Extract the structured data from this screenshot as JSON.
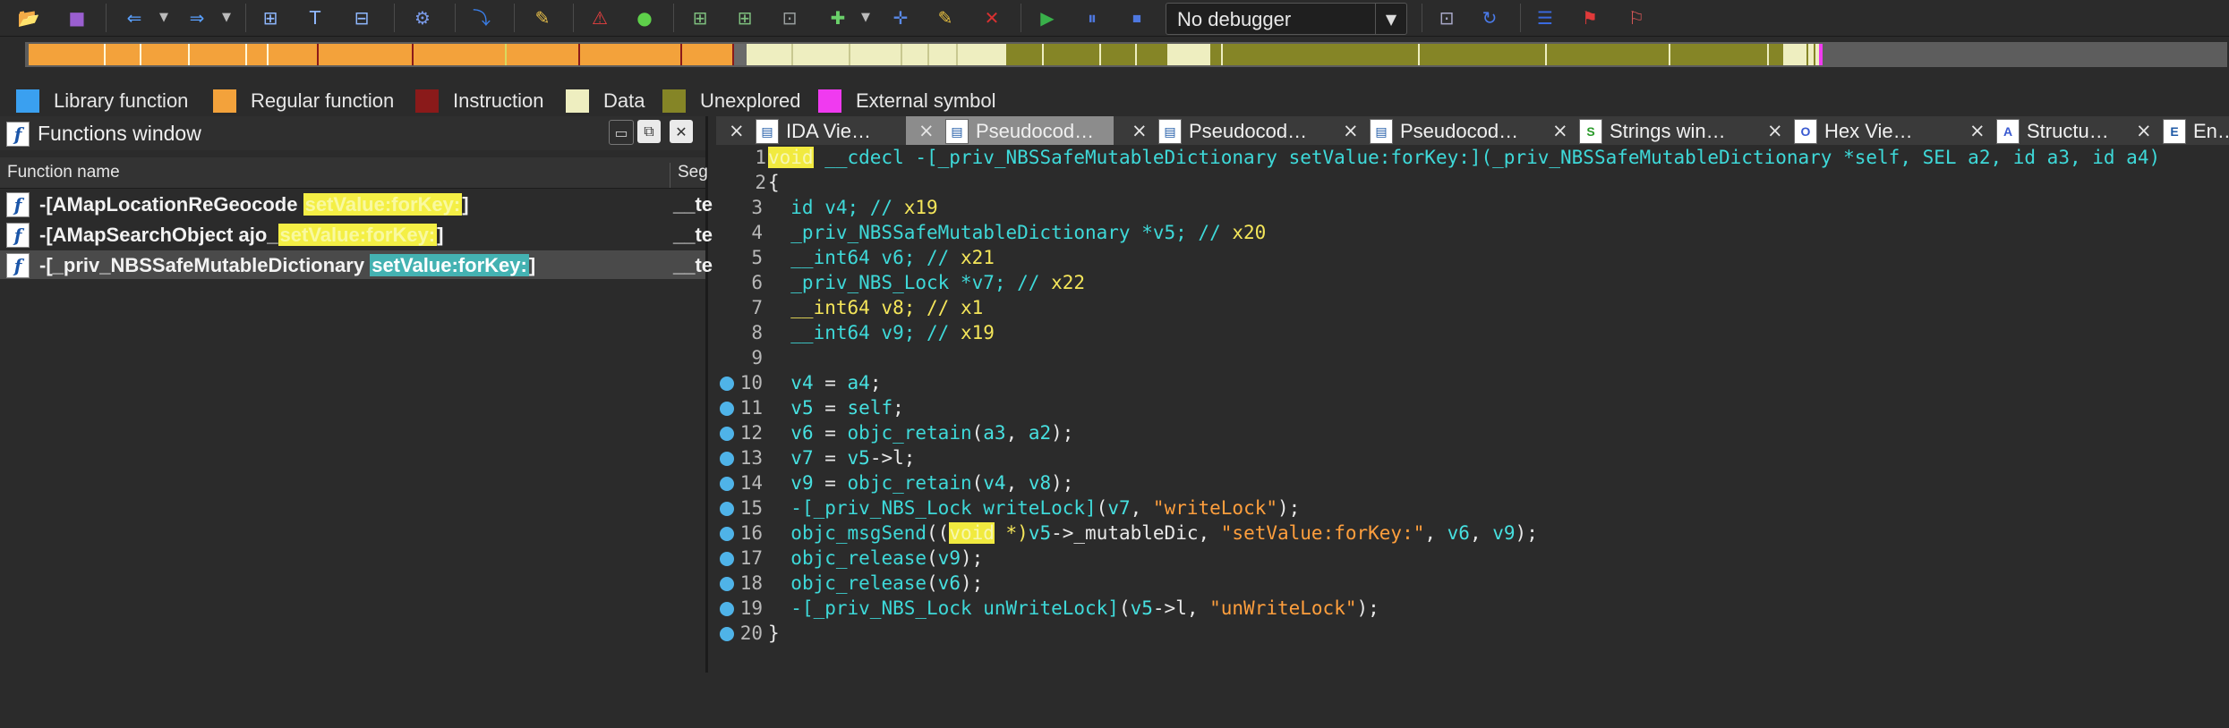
{
  "toolbar": {
    "debugger_label": "No debugger",
    "icons": [
      "open-icon",
      "save-icon",
      "back-icon",
      "forward-icon",
      "jump-icon",
      "graph-icon",
      "proximity-icon",
      "run-script-icon",
      "breakpoint-icon",
      "warning-icon",
      "go-icon",
      "struct-icon",
      "enum-icon",
      "segment-icon",
      "add-icon",
      "plus-icon",
      "edit-icon",
      "delete-icon",
      "start-icon",
      "pause-icon",
      "stop-icon"
    ]
  },
  "legend": [
    {
      "label": "Library function",
      "color": "#3aa0f0"
    },
    {
      "label": "Regular function",
      "color": "#f3a23b"
    },
    {
      "label": "Instruction",
      "color": "#8a1a1a"
    },
    {
      "label": "Data",
      "color": "#eeeec0"
    },
    {
      "label": "Unexplored",
      "color": "#858526"
    },
    {
      "label": "External symbol",
      "color": "#f03af0"
    }
  ],
  "functions_window": {
    "title": "Functions window",
    "columns": [
      "Function name",
      "Seg"
    ],
    "rows": [
      {
        "prefix": "-[AMapLocationReGeocode ",
        "match": "setValue:forKey:",
        "suffix": "]",
        "segment": "__te"
      },
      {
        "prefix": "-[AMapSearchObject ajo_",
        "match": "setValue:forKey:",
        "suffix": "]",
        "segment": "__te"
      },
      {
        "prefix": "-[_priv_NBSSafeMutableDictionary ",
        "match": "setValue:forKey:",
        "suffix": "]",
        "segment": "__te"
      }
    ]
  },
  "tabs": [
    {
      "label": "IDA Vie…",
      "icon": "ida-view-icon"
    },
    {
      "label": "Pseudocod…",
      "icon": "pseudocode-icon",
      "active": true
    },
    {
      "label": "Pseudocod…",
      "icon": "pseudocode-icon"
    },
    {
      "label": "Pseudocod…",
      "icon": "pseudocode-icon"
    },
    {
      "label": "Strings win…",
      "icon": "strings-icon"
    },
    {
      "label": "Hex Vie…",
      "icon": "hex-icon"
    },
    {
      "label": "Structu…",
      "icon": "structures-icon"
    },
    {
      "label": "En…",
      "icon": "enums-icon"
    }
  ],
  "code": {
    "line_numbers": [
      "1",
      "2",
      "3",
      "4",
      "5",
      "6",
      "7",
      "8",
      "9",
      "10",
      "11",
      "12",
      "13",
      "14",
      "15",
      "16",
      "17",
      "18",
      "19",
      "20"
    ],
    "l1": {
      "kw": "void",
      "a": " __cdecl -[_priv_NBSSafeMutableDictionary setValue:forKey:](_priv_NBSSafeMutableDictionary *self, SEL a2, id a3, id a4)"
    },
    "l2": "{",
    "l3": {
      "a": "  id v4; // ",
      "reg": "x19"
    },
    "l4": {
      "a": "  _priv_NBSSafeMutableDictionary *v5; // ",
      "reg": "x20"
    },
    "l5": {
      "a": "  __int64 v6; // ",
      "reg": "x21"
    },
    "l6": {
      "a": "  _priv_NBS_Lock *v7; // ",
      "reg": "x22"
    },
    "l7": {
      "a": "  __int64 v8; // ",
      "reg": "x1"
    },
    "l8": {
      "a": "  __int64 v9; // ",
      "reg": "x19"
    },
    "l10": {
      "v": "v4",
      "op": " = ",
      "r": "a4",
      ";": ";"
    },
    "l11": {
      "v": "v5",
      "op": " = ",
      "r": "self",
      ";": ";"
    },
    "l12": {
      "v": "v6",
      "op": " = ",
      "f": "objc_retain",
      "a1": "a3",
      "a2": "a2"
    },
    "l13": {
      "v": "v7",
      "op": " = ",
      "r": "v5",
      "m": "->l;"
    },
    "l14": {
      "v": "v9",
      "op": " = ",
      "f": "objc_retain",
      "a1": "v4",
      "a2": "v8"
    },
    "l15": {
      "call": "-[_priv_NBS_Lock writeLock]",
      "arg": "v7",
      "str": "\"writeLock\""
    },
    "l16": {
      "f": "objc_msgSend",
      "kw": "void",
      "cast": " *)",
      "v": "v5",
      "m": "->_mutableDic, ",
      "str": "\"setValue:forKey:\"",
      "a1": "v6",
      "a2": "v9"
    },
    "l17": {
      "f": "objc_release",
      "a": "v9"
    },
    "l18": {
      "f": "objc_release",
      "a": "v6"
    },
    "l19": {
      "call": "-[_priv_NBS_Lock unWriteLock]",
      "arg": "v5",
      "m": "->l, ",
      "str": "\"unWriteLock\""
    },
    "l20": "}"
  }
}
